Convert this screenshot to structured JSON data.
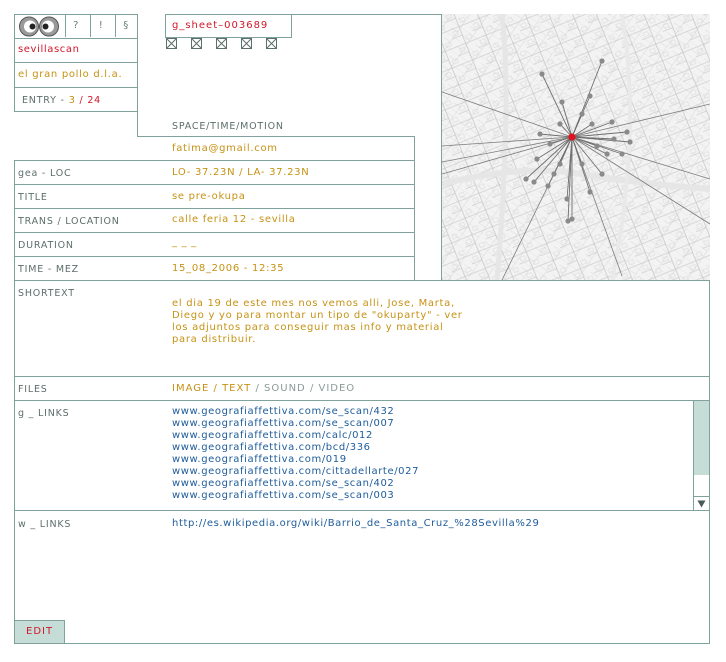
{
  "header": {
    "app_name": "sevillascan",
    "subtitle": "el gran pollo d.l.a.",
    "sheet_id": "g_sheet–003689",
    "icons": [
      "?",
      "!",
      "§"
    ],
    "checkbox_count": 5,
    "entry_label": "ENTRY -",
    "entry_current": "3",
    "entry_sep": "/",
    "entry_total": "24"
  },
  "fields": {
    "section_header": "SPACE/TIME/MOTION",
    "email": "fatima@gmail.com",
    "geo_label": "gea - LOC",
    "geo_value": "LO- 37.23N  /  LA- 37.23N",
    "title_label": "TITLE",
    "title_value": "se pre-okupa",
    "trans_label": "TRANS / LOCATION",
    "trans_value": "calle feria 12 - sevilla",
    "duration_label": "DURATION",
    "duration_value": "_ _ _",
    "time_label": "TIME - MEZ",
    "time_value": "15_08_2006 - 12:35",
    "shorttext_label": "SHORTEXT",
    "shorttext_lines": [
      "el dia 19 de este mes nos vemos alli, Jose, Marta,",
      "Diego y yo para montar un tipo de \"okuparty\" - ver",
      "los adjuntos para conseguir mas info y material",
      "para distribuir."
    ]
  },
  "files": {
    "label": "FILES",
    "types": [
      "IMAGE",
      "TEXT",
      "SOUND",
      "VIDEO"
    ],
    "sep": "/"
  },
  "g_links": {
    "label": "g _ LINKS",
    "items": [
      "www.geografiaffettiva.com/se_scan/432",
      "www.geografiaffettiva.com/se_scan/007",
      "www.geografiaffettiva.com/calc/012",
      "www.geografiaffettiva.com/bcd/336",
      "www.geografiaffettiva.com/019",
      "www.geografiaffettiva.com/cittadellarte/027",
      "www.geografiaffettiva.com/se_scan/402",
      "www.geografiaffettiva.com/se_scan/003"
    ]
  },
  "w_links": {
    "label": "w _ LINKS",
    "items": [
      "http://es.wikipedia.org/wiki/Barrio_de_Santa_Cruz_%28Sevilla%29"
    ]
  },
  "edit_button": "EDIT",
  "colors": {
    "line": "#7fa39c",
    "label": "#5c6f6c",
    "value": "#c69214",
    "accent_red": "#d0172a",
    "link_blue": "#1e5c9a",
    "scrollbar": "#c5ddd6"
  }
}
